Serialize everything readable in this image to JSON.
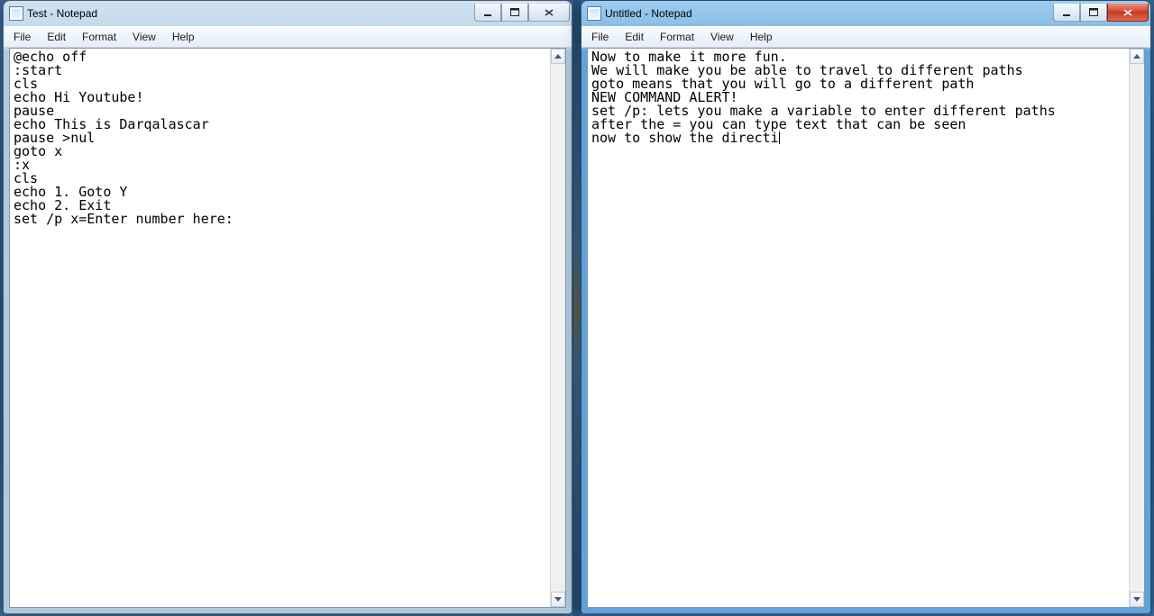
{
  "left_window": {
    "title": "Test - Notepad",
    "active": false,
    "menus": {
      "file": "File",
      "edit": "Edit",
      "format": "Format",
      "view": "View",
      "help": "Help"
    },
    "content": "@echo off\n:start\ncls\necho Hi Youtube!\npause\necho This is Darqalascar\npause >nul\ngoto x\n:x\ncls\necho 1. Goto Y\necho 2. Exit\nset /p x=Enter number here:"
  },
  "right_window": {
    "title": "Untitled - Notepad",
    "active": true,
    "menus": {
      "file": "File",
      "edit": "Edit",
      "format": "Format",
      "view": "View",
      "help": "Help"
    },
    "content_before_caret": "Now to make it more fun.\nWe will make you be able to travel to different paths\ngoto means that you will go to a different path\nNEW COMMAND ALERT!\nset /p: lets you make a variable to enter different paths\nafter the = you can type text that can be seen\nnow to show the directi",
    "content_after_caret": ""
  }
}
